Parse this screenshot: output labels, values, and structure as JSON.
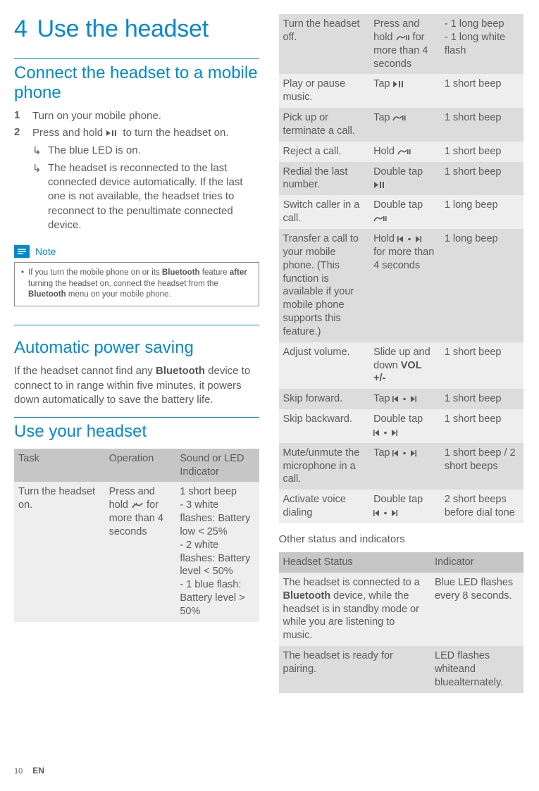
{
  "chapter_num": "4",
  "chapter_title": "Use the headset",
  "sec_connect": {
    "title": "Connect the headset to a mobile phone",
    "steps": [
      {
        "num": "1",
        "text": "Turn on your mobile phone."
      },
      {
        "num": "2",
        "lead": "Press and hold ",
        "trail": " to turn the headset on.",
        "subs": [
          "The blue LED is on.",
          "The headset is reconnected to the last connected device automatically. If the last one is not available, the headset tries to reconnect to the penultimate connected device."
        ]
      }
    ]
  },
  "note": {
    "label": "Note",
    "text_a": "If you turn the mobile phone on or its ",
    "b1": "Bluetooth",
    "text_b": " feature ",
    "b2": "after",
    "text_c": " turning the headset on, connect the headset from the ",
    "b3": "Bluetooth",
    "text_d": " menu on your mobile phone."
  },
  "sec_auto": {
    "title": "Automatic power saving",
    "p_a": "If the headset cannot find any ",
    "b1": "Bluetooth",
    "p_b": " device to connect to in range within five minutes, it powers down automatically to save the battery life."
  },
  "sec_use": {
    "title": "Use your headset",
    "headers": [
      "Task",
      "Operation",
      "Sound or LED Indicator"
    ],
    "rows": [
      {
        "c": "lt",
        "task": "Turn the headset on.",
        "op_a": "Press and hold ",
        "op_icon": "call",
        "op_b": " for more than 4 seconds",
        "ind": "1 short beep\n- 3 white flashes: Battery low < 25%\n- 2 white flashes: Battery level < 50%\n- 1 blue flash: Battery level > 50%"
      },
      {
        "c": "dk",
        "task": "Turn the headset off.",
        "op_a": "Press and hold ",
        "op_icon": "call",
        "op_b": " for more than 4 seconds",
        "ind": "- 1 long beep\n- 1 long white flash"
      },
      {
        "c": "lt",
        "task": "Play or pause music.",
        "op_a": "Tap ",
        "op_icon": "play",
        "op_b": "",
        "ind": "1 short beep"
      },
      {
        "c": "dk",
        "task": "Pick up or terminate a call.",
        "op_a": "Tap ",
        "op_icon": "call",
        "op_b": "",
        "ind": "1 short beep"
      },
      {
        "c": "lt",
        "task": "Reject a call.",
        "op_a": "Hold ",
        "op_icon": "call",
        "op_b": "",
        "ind": "1 short beep"
      },
      {
        "c": "dk",
        "task": "Redial the last number.",
        "op_a": "Double tap ",
        "op_icon": "play",
        "op_b": "",
        "ind": "1 short beep"
      },
      {
        "c": "lt",
        "task": "Switch caller in a call.",
        "op_a": "Double tap ",
        "op_icon": "call",
        "op_b": "",
        "ind": "1 long beep"
      },
      {
        "c": "dk",
        "task": "Transfer a call to your mobile phone. (This function is available if your mobile phone supports this feature.)",
        "op_a": "Hold ",
        "op_icon": "skip",
        "op_b": " for more than 4 seconds",
        "ind": "1 long beep"
      },
      {
        "c": "lt",
        "task": "Adjust volume.",
        "op_a": "Slide up and down ",
        "op_bold": "VOL +/-",
        "op_b": "",
        "ind": "1 short beep"
      },
      {
        "c": "dk",
        "task": "Skip forward.",
        "op_a": "Tap ",
        "op_icon": "skip",
        "op_b": "",
        "ind": "1 short beep"
      },
      {
        "c": "lt",
        "task": "Skip backward.",
        "op_a": "Double tap ",
        "op_icon": "skip",
        "op_b": "",
        "ind": "1 short beep"
      },
      {
        "c": "dk",
        "task": "Mute/unmute the microphone in a call.",
        "op_a": "Tap ",
        "op_icon": "skip",
        "op_b": "",
        "ind": "1 short beep / 2 short beeps"
      },
      {
        "c": "lt",
        "task": "Activate voice dialing",
        "op_a": "Double tap ",
        "op_icon": "skip",
        "op_b": "",
        "ind": "2 short beeps before dial tone"
      }
    ]
  },
  "other_head": "Other status and indicators",
  "status": {
    "headers": [
      "Headset Status",
      "Indicator"
    ],
    "rows": [
      {
        "c": "lt",
        "s_a": "The headset is connected to a ",
        "b": "Bluetooth",
        "s_b": " device, while the headset is in standby mode or while you are listening to music.",
        "ind": "Blue LED flashes every 8 seconds."
      },
      {
        "c": "dk",
        "s_a": "The headset is ready for pairing.",
        "b": "",
        "s_b": "",
        "ind": "LED flashes whiteand bluealternately."
      }
    ]
  },
  "footer": {
    "page": "10",
    "lang": "EN"
  }
}
